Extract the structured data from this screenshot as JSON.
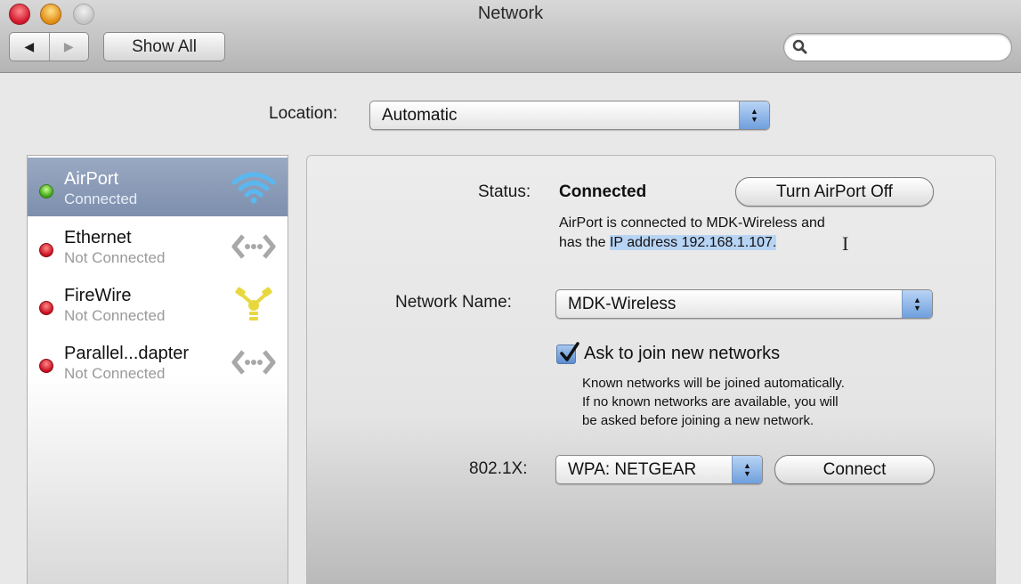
{
  "window": {
    "title": "Network",
    "traffic_lights": [
      "close",
      "minimize",
      "zoom"
    ]
  },
  "toolbar": {
    "back_icon": "back-arrow-icon",
    "forward_icon": "forward-arrow-icon",
    "back_glyph": "◀",
    "forward_glyph": "▶",
    "show_all_label": "Show All",
    "search": {
      "value": "",
      "placeholder": "",
      "icon": "search-icon"
    }
  },
  "location": {
    "label": "Location:",
    "value": "Automatic"
  },
  "stepper_glyphs": {
    "up": "▲",
    "down": "▼"
  },
  "services": [
    {
      "name": "AirPort",
      "status": "Connected",
      "indicator": "green",
      "icon": "wifi-icon",
      "selected": true
    },
    {
      "name": "Ethernet",
      "status": "Not Connected",
      "indicator": "red",
      "icon": "ethernet-icon",
      "selected": false
    },
    {
      "name": "FireWire",
      "status": "Not Connected",
      "indicator": "red",
      "icon": "firewire-icon",
      "selected": false
    },
    {
      "name": "Parallel...dapter",
      "status": "Not Connected",
      "indicator": "red",
      "icon": "ethernet-icon",
      "selected": false
    }
  ],
  "detail": {
    "status_label": "Status:",
    "status_value": "Connected",
    "turn_off_label": "Turn AirPort Off",
    "description_line1": "AirPort is connected to MDK-Wireless and",
    "description_line2_prefix": "has the ",
    "description_line2_selected": "IP address 192.168.1.107.",
    "network_name_label": "Network Name:",
    "network_name_value": "MDK-Wireless",
    "ask_to_join_label": "Ask to join new networks",
    "ask_to_join_checked": true,
    "help_line1": "Known networks will be joined automatically.",
    "help_line2": "If no known networks are available, you will",
    "help_line3": "be asked before joining a new network.",
    "dot1x_label": "802.1X:",
    "dot1x_value": "WPA: NETGEAR",
    "connect_label": "Connect"
  },
  "colors": {
    "selection_blue": "#b8d4f4",
    "sidebar_selected": "#8797b5",
    "status_green": "#3aa012",
    "status_red": "#c80c1c"
  }
}
